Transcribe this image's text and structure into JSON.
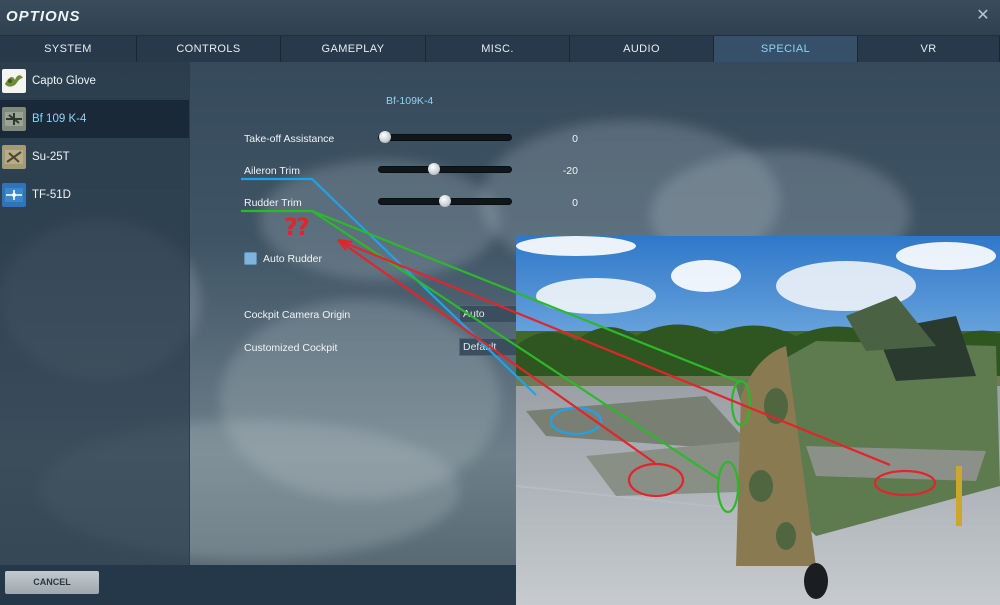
{
  "window": {
    "title": "OPTIONS",
    "close_symbol": "✕"
  },
  "tabs": [
    {
      "label": "SYSTEM",
      "active": false
    },
    {
      "label": "CONTROLS",
      "active": false
    },
    {
      "label": "GAMEPLAY",
      "active": false
    },
    {
      "label": "MISC.",
      "active": false
    },
    {
      "label": "AUDIO",
      "active": false
    },
    {
      "label": "SPECIAL",
      "active": true
    },
    {
      "label": "VR",
      "active": false
    }
  ],
  "sidebar": {
    "items": [
      {
        "label": "Capto Glove",
        "icon": "capto-glove-icon",
        "active": false
      },
      {
        "label": "Bf 109 K-4",
        "icon": "bf109-icon",
        "active": true
      },
      {
        "label": "Su-25T",
        "icon": "su25t-icon",
        "active": false
      },
      {
        "label": "TF-51D",
        "icon": "tf51d-icon",
        "active": false
      }
    ]
  },
  "panel": {
    "title": "Bf-109K-4",
    "sliders": [
      {
        "label": "Take-off Assistance",
        "value": "0",
        "level": 0.0
      },
      {
        "label": "Aileron Trim",
        "value": "-20",
        "level": 0.41
      },
      {
        "label": "Rudder Trim",
        "value": "0",
        "level": 0.5
      }
    ],
    "auto_rudder": {
      "label": "Auto Rudder",
      "checked": true
    },
    "cockpit_camera_origin": {
      "label": "Cockpit Camera Origin",
      "value": "Auto"
    },
    "customized_cockpit": {
      "label": "Customized Cockpit",
      "value": "Default"
    }
  },
  "annotation": {
    "question_marks": "??"
  },
  "footer": {
    "cancel_label": "CANCEL"
  },
  "colors": {
    "accent": "#8fd3f4",
    "active_tab": "#36506a",
    "line_blue": "#1ea3e8",
    "line_green": "#2db82b",
    "line_red": "#e1252b"
  }
}
